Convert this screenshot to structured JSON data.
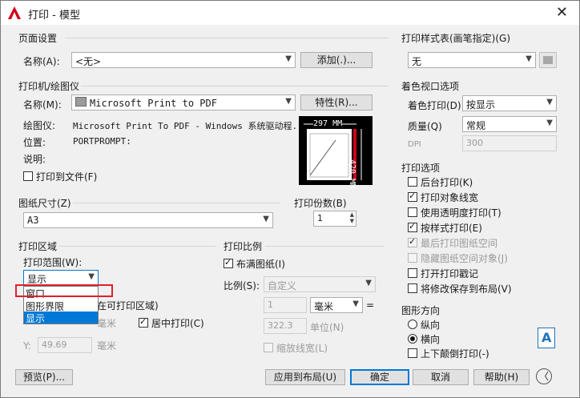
{
  "window": {
    "title": "打印 - 模型",
    "close": "✕"
  },
  "page_setup": {
    "group": "页面设置",
    "name_label": "名称(A):",
    "name_value": "<无>",
    "add_button": "添加(.)..."
  },
  "printer": {
    "group": "打印机/绘图仪",
    "name_label": "名称(M):",
    "name_value": "Microsoft Print to PDF",
    "properties_button": "特性(R)...",
    "plotter_label": "绘图仪:",
    "plotter_value": "Microsoft Print To PDF - Windows 系统驱动程...",
    "location_label": "位置:",
    "location_value": "PORTPROMPT:",
    "description_label": "说明:",
    "print_to_file": "打印到文件(F)",
    "preview_width": "297 MM",
    "preview_height": "420 MM"
  },
  "paper_size": {
    "group": "图纸尺寸(Z)",
    "value": "A3"
  },
  "copies": {
    "group": "打印份数(B)",
    "value": "1"
  },
  "plot_area": {
    "group": "打印区域",
    "range_label": "打印范围(W):",
    "range_value": "显示",
    "dropdown_options": [
      "窗口",
      "图形界限",
      "显示"
    ],
    "offset_group_tail": "在可打印区域)",
    "center_print": "居中打印(C)",
    "x_unit": "毫米",
    "y_label": "Y:",
    "y_value": "49.69",
    "y_unit": "毫米"
  },
  "plot_scale": {
    "group": "打印比例",
    "fit_paper": "布满图纸(I)",
    "scale_label": "比例(S):",
    "scale_value": "自定义",
    "value1": "1",
    "unit": "毫米",
    "eq": "=",
    "value2": "322.3",
    "unit2": "单位(N)",
    "lineweight_scale": "缩放线宽(L)"
  },
  "style_table": {
    "group": "打印样式表(画笔指定)(G)",
    "value": "无"
  },
  "shaded_viewport": {
    "group": "着色视口选项",
    "shade_label": "着色打印(D)",
    "shade_value": "按显示",
    "quality_label": "质量(Q)",
    "quality_value": "常规",
    "dpi_label": "DPI",
    "dpi_value": "300"
  },
  "plot_options": {
    "group": "打印选项",
    "items": [
      {
        "label": "后台打印(K)",
        "checked": false,
        "disabled": false
      },
      {
        "label": "打印对象线宽",
        "checked": true,
        "disabled": false
      },
      {
        "label": "使用透明度打印(T)",
        "checked": false,
        "disabled": false
      },
      {
        "label": "按样式打印(E)",
        "checked": true,
        "disabled": false
      },
      {
        "label": "最后打印图纸空间",
        "checked": true,
        "disabled": true
      },
      {
        "label": "隐藏图纸空间对象(J)",
        "checked": false,
        "disabled": true
      },
      {
        "label": "打开打印戳记",
        "checked": false,
        "disabled": false
      },
      {
        "label": "将修改保存到布局(V)",
        "checked": false,
        "disabled": false
      }
    ]
  },
  "orientation": {
    "group": "图形方向",
    "portrait": "纵向",
    "landscape": "横向",
    "upside_down": "上下颠倒打印(-)",
    "icon_letter": "A"
  },
  "footer": {
    "preview": "预览(P)...",
    "apply_layout": "应用到布局(U)",
    "ok": "确定",
    "cancel": "取消",
    "help": "帮助(H)",
    "more": "〈"
  }
}
